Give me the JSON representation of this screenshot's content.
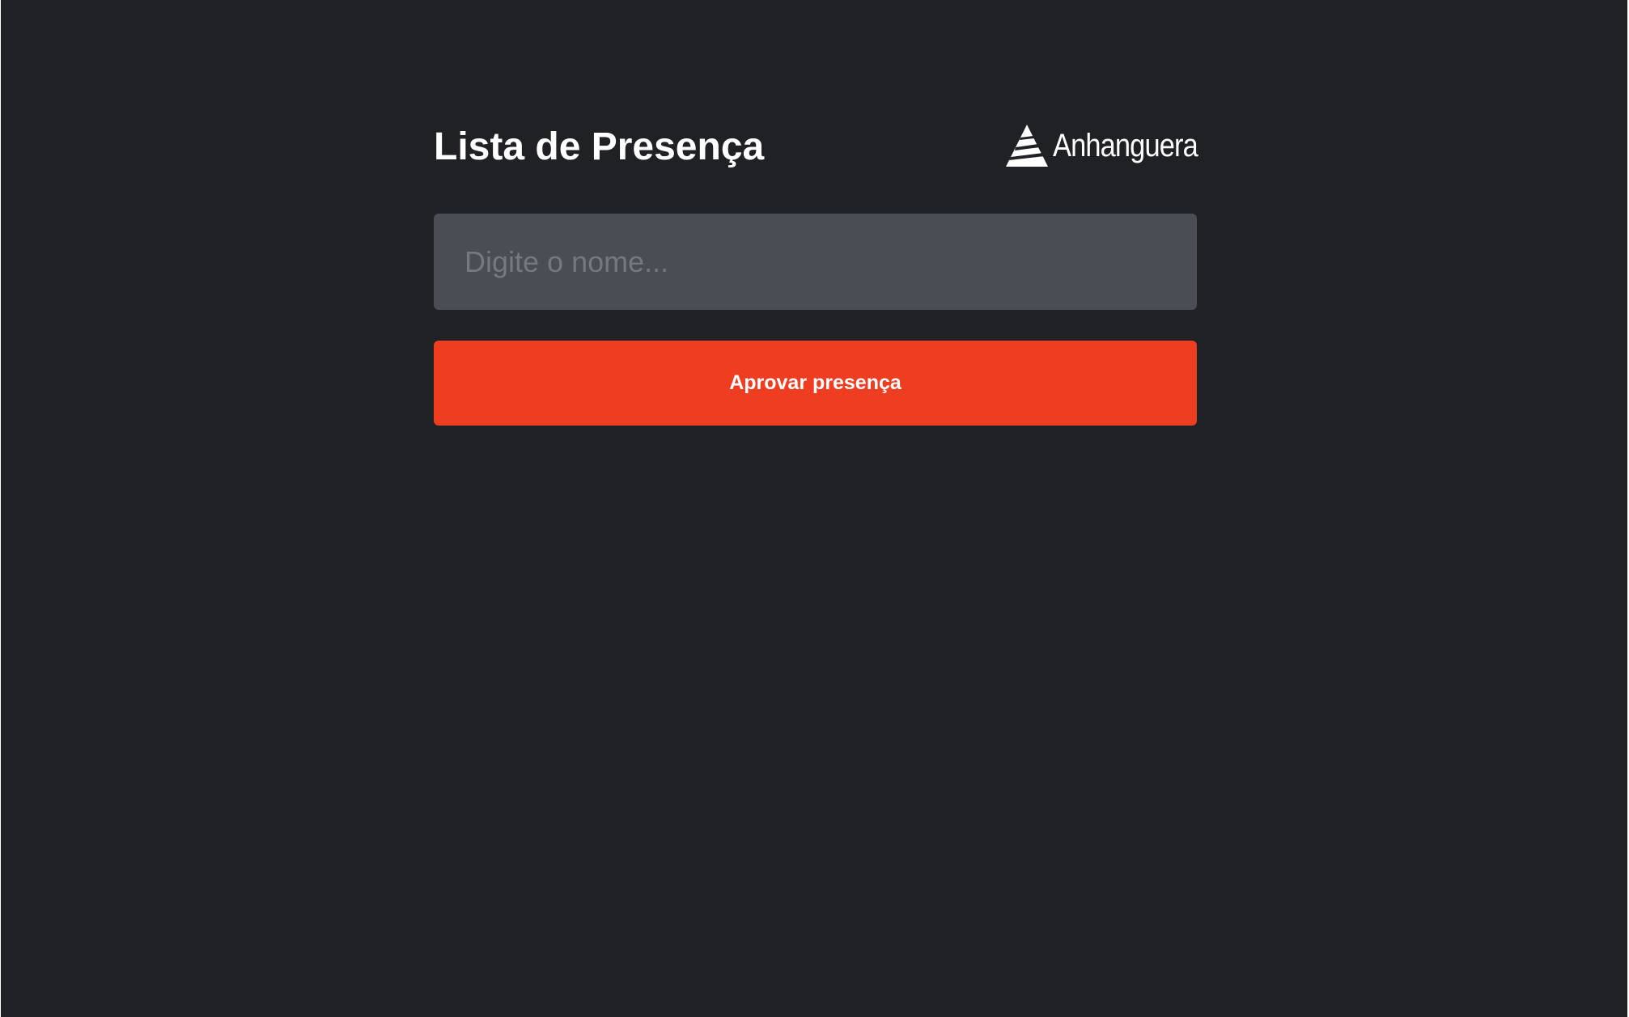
{
  "header": {
    "title": "Lista de Presença",
    "brand_name": "Anhanguera",
    "brand_icon": "anhanguera-logo-icon"
  },
  "form": {
    "name_input": {
      "value": "",
      "placeholder": "Digite o nome..."
    },
    "approve_label": "Aprovar presença"
  },
  "colors": {
    "background": "#202124",
    "input_background": "#4a4d54",
    "placeholder": "#75787e",
    "accent": "#ef3d22",
    "text": "#ffffff"
  }
}
